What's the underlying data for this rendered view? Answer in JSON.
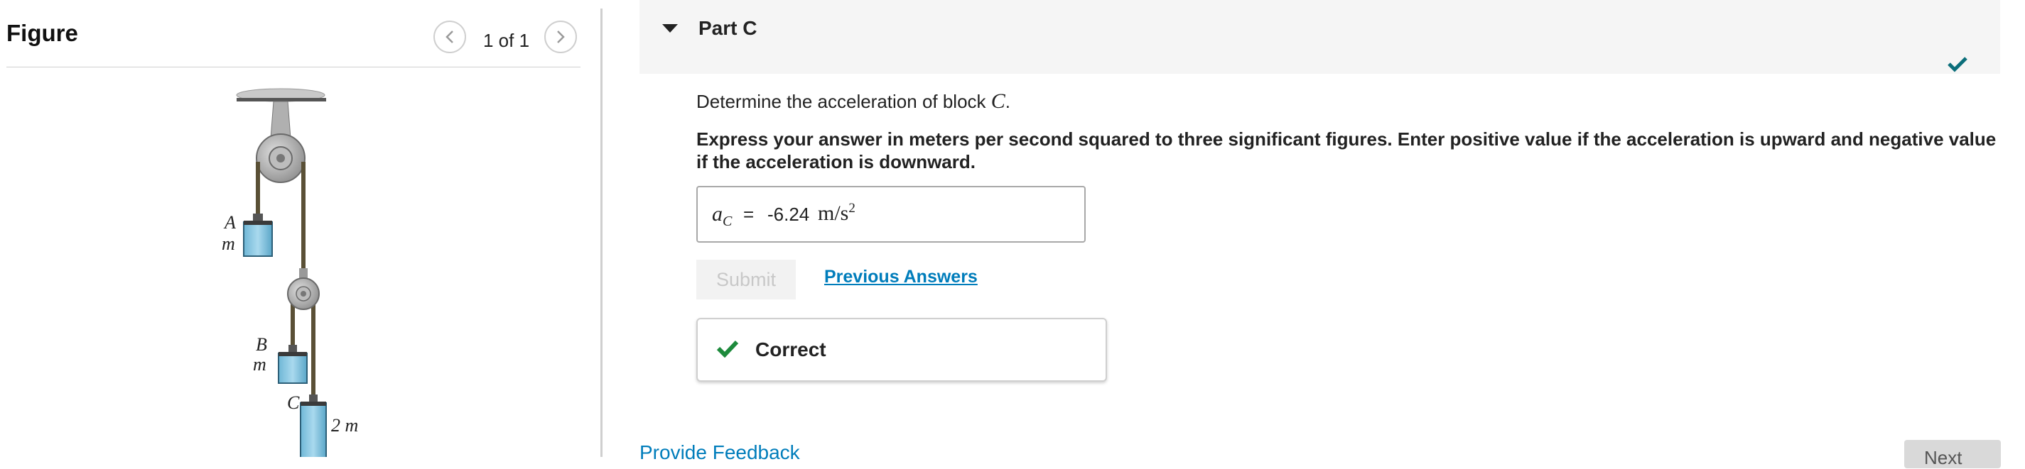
{
  "figure_panel": {
    "title": "Figure",
    "page_count": "1 of 1",
    "diagram": {
      "label_a": "A",
      "mass_a": "m",
      "label_b": "B",
      "mass_b": "m",
      "label_c": "C",
      "mass_c": "2 m"
    }
  },
  "part": {
    "title": "Part C",
    "question_prefix": "Determine the acceleration of block ",
    "question_var": "C",
    "question_suffix": ".",
    "instructions": "Express your answer in meters per second squared to three significant figures. Enter positive value if the acceleration is upward and negative value if the acceleration is downward.",
    "answer": {
      "var": "a",
      "var_sub": "C",
      "equals": "=",
      "value": "-6.24",
      "unit": "m/s",
      "unit_exp": "2"
    },
    "submit_label": "Submit",
    "previous_answers_label": "Previous Answers",
    "result_label": "Correct"
  },
  "footer": {
    "feedback_label": "Provide Feedback",
    "next_label": "Next"
  },
  "colors": {
    "link": "#007dbb",
    "success": "#1d8a3c",
    "check_teal": "#0b6e7a"
  }
}
